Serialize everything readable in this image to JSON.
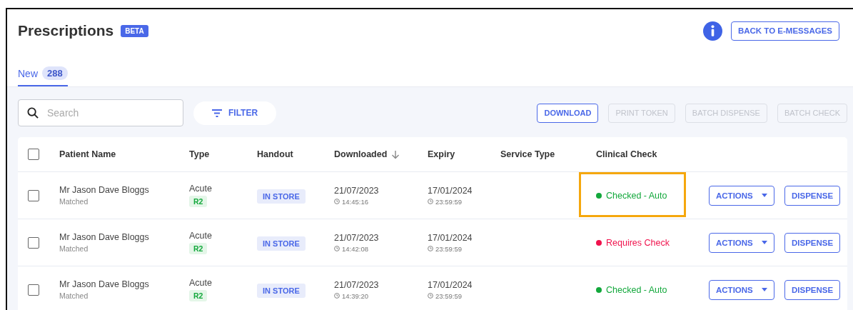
{
  "header": {
    "title": "Prescriptions",
    "badge": "BETA",
    "back_button": "BACK TO E-MESSAGES"
  },
  "tabs": [
    {
      "label": "New",
      "count": "288",
      "selected": true
    }
  ],
  "toolbar": {
    "search": {
      "placeholder": "Search"
    },
    "filter": "FILTER",
    "buttons": [
      {
        "label": "DOWNLOAD",
        "disabled": false
      },
      {
        "label": "PRINT TOKEN",
        "disabled": true
      },
      {
        "label": "BATCH DISPENSE",
        "disabled": true
      },
      {
        "label": "BATCH CHECK",
        "disabled": true
      }
    ]
  },
  "table": {
    "select_all_checked": false,
    "columns": [
      {
        "label": "Patient Name",
        "sorted": false
      },
      {
        "label": "Type",
        "sorted": false
      },
      {
        "label": "Handout",
        "sorted": false
      },
      {
        "label": "Downloaded",
        "sorted": true
      },
      {
        "label": "Expiry",
        "sorted": false
      },
      {
        "label": "Service Type",
        "sorted": false
      },
      {
        "label": "Clinical Check",
        "sorted": false
      }
    ],
    "rows": [
      {
        "checked": false,
        "patient": "Mr Jason Dave Bloggs",
        "match": "Matched",
        "type": "Acute",
        "type_tag": "R2",
        "handout": "IN STORE",
        "downloaded_date": "21/07/2023",
        "downloaded_time": "14:45:16",
        "expiry_date": "17/01/2024",
        "expiry_time": "23:59:59",
        "clinical_check": "Checked - Auto",
        "color": "#13a83c",
        "highlighted": true,
        "actions": "ACTIONS",
        "dispense": "DISPENSE"
      },
      {
        "checked": false,
        "patient": "Mr Jason Dave Bloggs",
        "match": "Matched",
        "type": "Acute",
        "type_tag": "R2",
        "handout": "IN STORE",
        "downloaded_date": "21/07/2023",
        "downloaded_time": "14:42:08",
        "expiry_date": "17/01/2024",
        "expiry_time": "23:59:59",
        "clinical_check": "Requires Check",
        "color": "#f0134d",
        "highlighted": false,
        "actions": "ACTIONS",
        "dispense": "DISPENSE"
      },
      {
        "checked": false,
        "patient": "Mr Jason Dave Bloggs",
        "match": "Matched",
        "type": "Acute",
        "type_tag": "R2",
        "handout": "IN STORE",
        "downloaded_date": "21/07/2023",
        "downloaded_time": "14:39:20",
        "expiry_date": "17/01/2024",
        "expiry_time": "23:59:59",
        "clinical_check": "Checked - Auto",
        "color": "#13a83c",
        "highlighted": false,
        "actions": "ACTIONS",
        "dispense": "DISPENSE"
      }
    ]
  }
}
